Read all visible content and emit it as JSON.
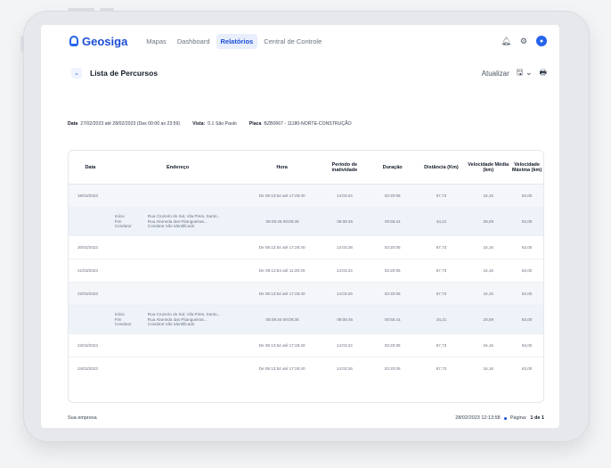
{
  "brand": {
    "name": "Geosiga"
  },
  "nav": {
    "items": [
      {
        "label": "Mapas"
      },
      {
        "label": "Dashboard"
      },
      {
        "label": "Relatórios"
      },
      {
        "label": "Central de Controle"
      }
    ],
    "active": "Relatórios"
  },
  "header_icons": [
    "bell-icon",
    "gear-icon",
    "user-avatar-icon"
  ],
  "page": {
    "title": "Lista de Percursos",
    "actions": {
      "refresh": "Atualizar"
    }
  },
  "filters": {
    "data_label": "Data",
    "data_value": "27/02/2023 até 28/02/2023 (Das 00:00 as 23:59)",
    "vista_label": "Vista:",
    "vista_value": "0.1 São Paulo",
    "placa_label": "Placa",
    "placa_value": "BZB0667 - 11180-NORTE-CONSTRUÇÃO"
  },
  "table": {
    "columns": [
      "Data",
      "Endereço",
      "Hora",
      "Período de inatividade",
      "Duração",
      "Distância (Km)",
      "Velocidade Média (km)",
      "Velocidade Máxima (km)"
    ],
    "rows": [
      {
        "type": "main",
        "data": "18/03/2023",
        "hora": "De 08:13:54 até 17:28:40",
        "periodo": "14:03:24",
        "duracao": "03:20:05",
        "distancia": "67,73",
        "vmedia": "16,16",
        "vmax": "63,00"
      },
      {
        "type": "sub",
        "labels": [
          "Início",
          "Fim",
          "Condutor"
        ],
        "values": [
          "Rua Cruzeiro do Sul, Vila Pires, Santo...",
          "Rua Alameda das Pitangueiras...",
          "Condutor não Identificado"
        ],
        "hora": "08:08:45 09:08:35",
        "periodo": "08:08:45",
        "duracao": "00:56:41",
        "distancia": "34,21",
        "vmedia": "28,09",
        "vmax": "63,00"
      },
      {
        "type": "main",
        "data": "20/02/2023",
        "hora": "De 08:13:54 até 17:28:40",
        "periodo": "14:03:28",
        "duracao": "03:20:05",
        "distancia": "67,73",
        "vmedia": "16,16",
        "vmax": "63,00"
      },
      {
        "type": "main",
        "data": "21/03/2023",
        "hora": "De 08:13:54 até 11:28:40",
        "periodo": "14:03:24",
        "duracao": "03:20:05",
        "distancia": "67,73",
        "vmedia": "16,16",
        "vmax": "63,00"
      },
      {
        "type": "main",
        "data": "22/03/2023",
        "hora": "De 08:13:54 até 17:28:40",
        "periodo": "14:03:26",
        "duracao": "03:20:05",
        "distancia": "67,73",
        "vmedia": "16,16",
        "vmax": "63,00"
      },
      {
        "type": "sub",
        "labels": [
          "Início",
          "Fim",
          "Condutor"
        ],
        "values": [
          "Rua Cruzeiro do Sul, Vila Pires, Santo...",
          "Rua Alameda das Pitangueiras...",
          "Condutor não Identificado"
        ],
        "hora": "08:08:45 09:09:35",
        "periodo": "08:08:45",
        "duracao": "00:55:41",
        "distancia": "34,21",
        "vmedia": "28,09",
        "vmax": "63,00"
      },
      {
        "type": "main",
        "data": "23/03/2023",
        "hora": "De 08:13:54 até 17:28:40",
        "periodo": "14:03:24",
        "duracao": "03:20:05",
        "distancia": "67,73",
        "vmedia": "16,16",
        "vmax": "63,00"
      },
      {
        "type": "main",
        "data": "24/03/2023",
        "hora": "De 08:13:54 até 17:28:40",
        "periodo": "14:03:26",
        "duracao": "03:20:05",
        "distancia": "67,73",
        "vmedia": "16,16",
        "vmax": "63,00"
      }
    ]
  },
  "footer": {
    "company": "Sua empresa",
    "timestamp": "28/02/2023 12:13:58",
    "page_label": "Página:",
    "page_value": "1 de 1"
  },
  "colors": {
    "accent": "#2563eb",
    "nav_active_bg": "#e8eefc",
    "row_shaded": "#f4f6fa"
  }
}
